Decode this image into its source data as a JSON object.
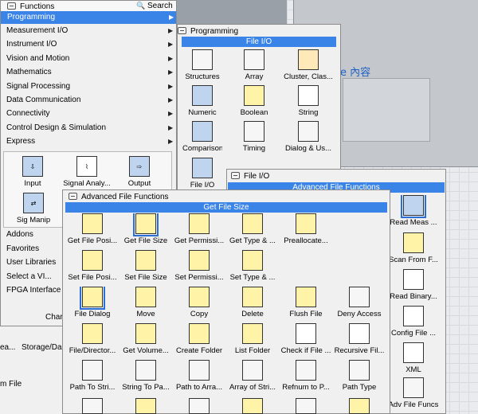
{
  "background": {
    "heading_fragment": "e 內容",
    "grid_color": "#e3e6ea",
    "panel_color": "#b8bcc2"
  },
  "functions_menu": {
    "title": "Functions",
    "search": "Search",
    "highlighted": "Programming",
    "items": [
      "Measurement I/O",
      "Instrument I/O",
      "Vision and Motion",
      "Mathematics",
      "Signal Processing",
      "Data Communication",
      "Connectivity",
      "Control Design & Simulation",
      "Express"
    ],
    "express_icons": [
      "Input",
      "Signal Analy...",
      "Output",
      "Sig Manip"
    ],
    "lower_items": [
      "Addons",
      "Favorites",
      "User Libraries",
      "Select a VI...",
      "FPGA Interface"
    ],
    "bottom_label": "Char"
  },
  "background_palette_fragments": [
    "ea...",
    "Storage/Da",
    "m File"
  ],
  "programming_palette": {
    "title": "Programming",
    "banner": "File I/O",
    "items": [
      "Structures",
      "Array",
      "Cluster, Clas...",
      "Numeric",
      "Boolean",
      "String",
      "Comparison",
      "Timing",
      "Dialog & Us...",
      "File I/O"
    ]
  },
  "fileio_palette": {
    "title": "File I/O",
    "banner": "Advanced File Functions",
    "right_items": [
      "Read Meas ...",
      "Scan From F...",
      "Read Binary...",
      "Config File ...",
      "XML",
      "Adv File Funcs"
    ]
  },
  "advanced_palette": {
    "title": "Advanced File Functions",
    "banner": "Get File Size",
    "rows": [
      [
        "Get File Posi...",
        "Get File Size",
        "Get Permissi...",
        "Get Type & ...",
        "Preallocate..."
      ],
      [
        "Set File Posi...",
        "Set File Size",
        "Set Permissi...",
        "Set Type & ..."
      ],
      [
        "File Dialog",
        "Move",
        "Copy",
        "Delete",
        "Flush File",
        "Deny Access"
      ],
      [
        "File/Director...",
        "Get Volume...",
        "Create Folder",
        "List Folder",
        "Check if File ...",
        "Recursive Fil..."
      ],
      [
        "Path To Stri...",
        "String To Pa...",
        "Path to Arra...",
        "Array of Stri...",
        "Refnum to P...",
        "Path Type"
      ]
    ]
  },
  "colors": {
    "highlight": "#3a84e8",
    "banner": "#3a84e8",
    "palette_bg": "#f0f0f0",
    "selection": "#2a6fd6"
  }
}
